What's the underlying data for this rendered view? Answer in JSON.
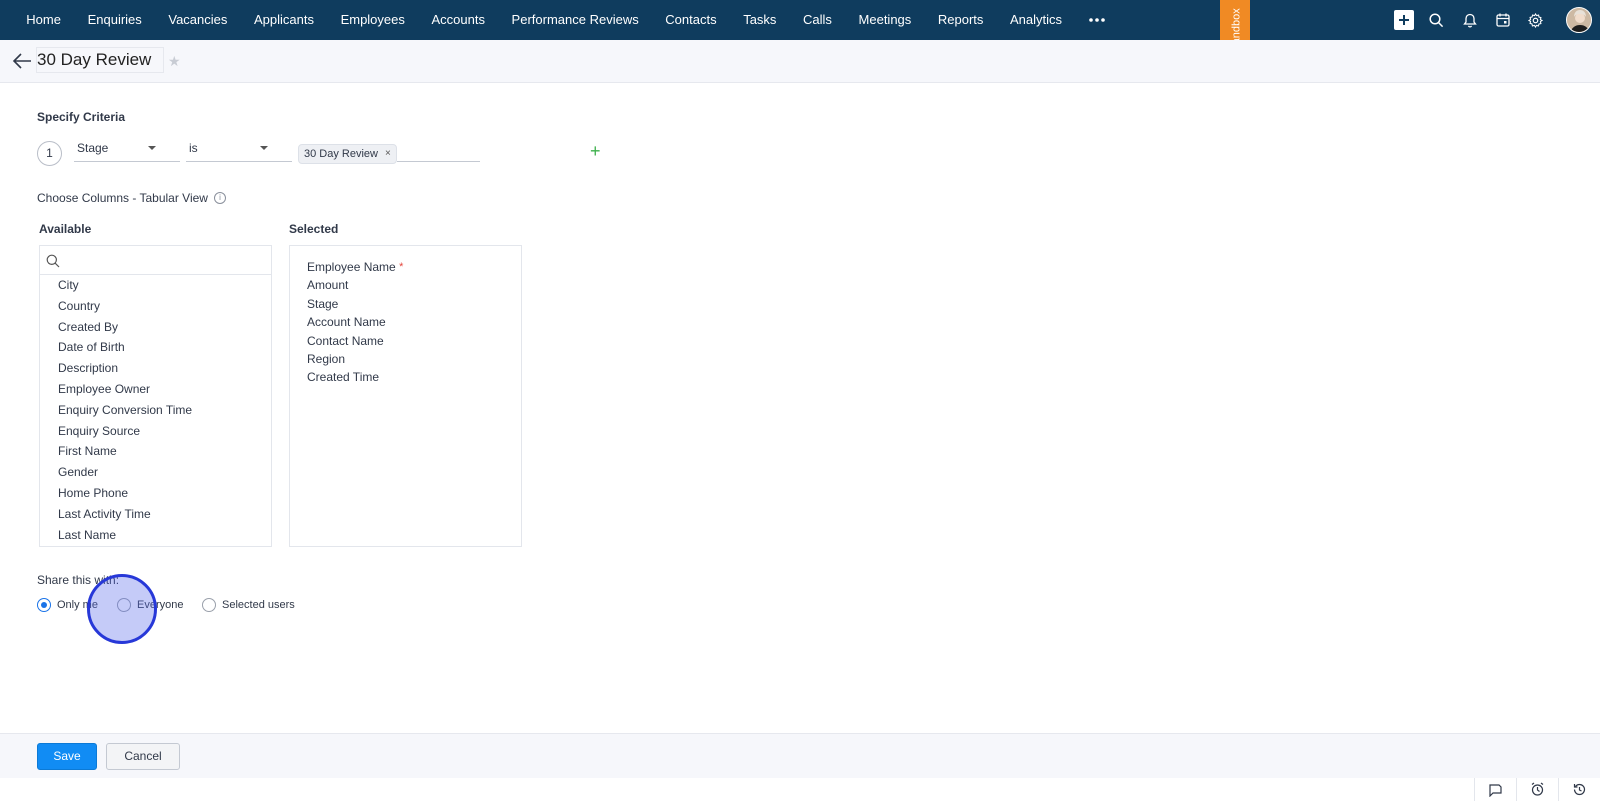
{
  "nav": {
    "items": [
      "Home",
      "Enquiries",
      "Vacancies",
      "Applicants",
      "Employees",
      "Accounts",
      "Performance Reviews",
      "Contacts",
      "Tasks",
      "Calls",
      "Meetings",
      "Reports",
      "Analytics"
    ],
    "more_icon": "more-horizontal-icon",
    "sandbox_label": "Sandbox",
    "right_icons": [
      "plus-icon",
      "search-icon",
      "bell-icon",
      "calendar-icon",
      "gear-icon"
    ]
  },
  "title": {
    "view_name": "30 Day Review"
  },
  "criteria": {
    "heading": "Specify Criteria",
    "rows": [
      {
        "number": "1",
        "field": "Stage",
        "operator": "is",
        "values": [
          "30 Day Review"
        ]
      }
    ]
  },
  "columns": {
    "label": "Choose Columns - Tabular View",
    "available_label": "Available",
    "selected_label": "Selected",
    "available": [
      "City",
      "Country",
      "Created By",
      "Date of Birth",
      "Description",
      "Employee Owner",
      "Enquiry Conversion Time",
      "Enquiry Source",
      "First Name",
      "Gender",
      "Home Phone",
      "Last Activity Time",
      "Last Name"
    ],
    "selected": [
      "Employee Name",
      "Amount",
      "Stage",
      "Account Name",
      "Contact Name",
      "Region",
      "Created Time"
    ],
    "required_marker": "*"
  },
  "share": {
    "label": "Share this with:",
    "options": [
      "Only me",
      "Everyone",
      "Selected users"
    ],
    "selected": "Only me"
  },
  "footer": {
    "save_label": "Save",
    "cancel_label": "Cancel"
  },
  "colors": {
    "nav_bg": "#0f3c5e",
    "sandbox": "#f08a24",
    "primary": "#118cf4",
    "add": "#3db04b"
  }
}
